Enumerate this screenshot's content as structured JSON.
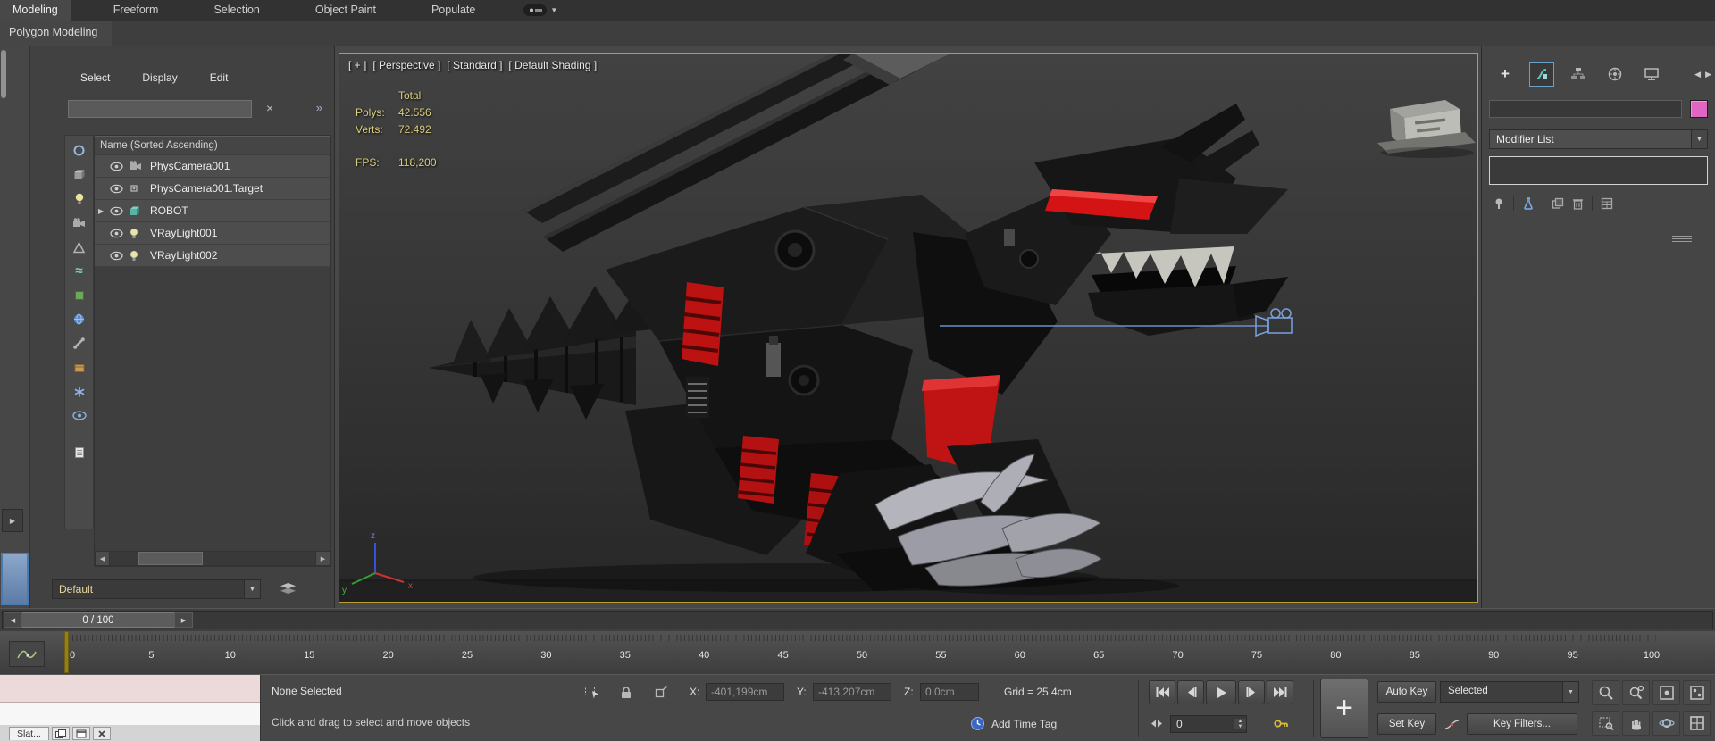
{
  "colors": {
    "viewport_border": "#bb9e33",
    "accent_red": "#c41414",
    "accent_blue": "#5a87c0",
    "stats_yellow": "#dbcd7f"
  },
  "icons": {
    "clear": "×",
    "chevrons": "»",
    "down": "▼",
    "up": "▲",
    "left": "◀",
    "right": "▶",
    "expander": "▶",
    "plus": "+",
    "waves": "≈"
  },
  "ribbon": {
    "tabs": [
      {
        "label": "Modeling",
        "active": true
      },
      {
        "label": "Freeform",
        "active": false
      },
      {
        "label": "Selection",
        "active": false
      },
      {
        "label": "Object Paint",
        "active": false
      },
      {
        "label": "Populate",
        "active": false
      }
    ],
    "panel_label": "Polygon Modeling"
  },
  "scene_explorer": {
    "menus": [
      "Select",
      "Display",
      "Edit"
    ],
    "search_value": "",
    "header": "Name (Sorted Ascending)",
    "items": [
      {
        "name": "PhysCamera001",
        "type": "camera",
        "expandable": false
      },
      {
        "name": "PhysCamera001.Target",
        "type": "target",
        "expandable": false
      },
      {
        "name": "ROBOT",
        "type": "geometry",
        "expandable": true
      },
      {
        "name": "VRayLight001",
        "type": "light",
        "expandable": false
      },
      {
        "name": "VRayLight002",
        "type": "light",
        "expandable": false
      }
    ],
    "selection_set": "Default"
  },
  "viewport": {
    "label_segments": [
      "[ + ]",
      "[ Perspective ]",
      "[ Standard ]",
      "[ Default Shading ]"
    ],
    "stats": {
      "total_label": "Total",
      "polys_label": "Polys:",
      "polys": "42.556",
      "verts_label": "Verts:",
      "verts": "72.492",
      "fps_label": "FPS:",
      "fps": "118,200"
    },
    "axis": {
      "x": "x",
      "y": "y",
      "z": "z"
    }
  },
  "command_panel": {
    "modifier_list_label": "Modifier List",
    "object_color": "#e066c4"
  },
  "timeline": {
    "frame_indicator": "0 / 100"
  },
  "trackbar": {
    "labels": [
      0,
      5,
      10,
      15,
      20,
      25,
      30,
      35,
      40,
      45,
      50,
      55,
      60,
      65,
      70,
      75,
      80,
      85,
      90,
      95,
      100
    ],
    "current_frame": 0
  },
  "status_bar": {
    "prompt_line1": "None Selected",
    "prompt_line2": "Click and drag to select and move objects",
    "x_label": "X:",
    "x_value": "-401,199cm",
    "y_label": "Y:",
    "y_value": "-413,207cm",
    "z_label": "Z:",
    "z_value": "0,0cm",
    "grid_label": "Grid = 25,4cm",
    "add_time_tag": "Add Time Tag",
    "auto_key": "Auto Key",
    "set_key": "Set Key",
    "selected_set": "Selected",
    "key_filters": "Key Filters...",
    "frame_field": "0",
    "listener_tab": "Slat..."
  }
}
